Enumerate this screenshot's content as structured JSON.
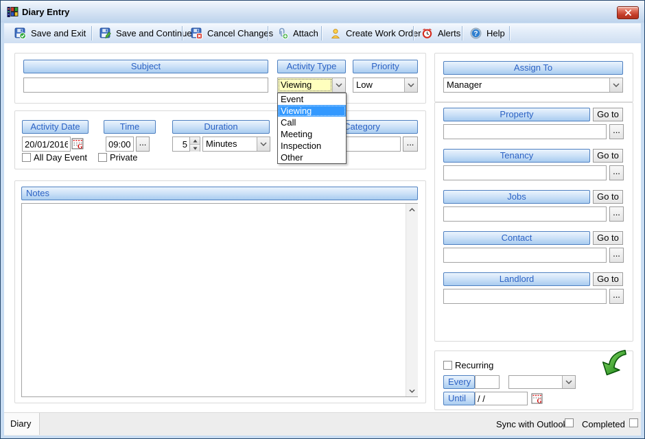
{
  "window": {
    "title": "Diary Entry"
  },
  "toolbar": {
    "buttons": [
      "Save and Exit",
      "Save and Continue",
      "Cancel Changes",
      "Attach",
      "Create Work Order",
      "Alerts",
      "Help"
    ]
  },
  "form": {
    "subject": {
      "header": "Subject",
      "value": ""
    },
    "activity_type": {
      "header": "Activity Type",
      "value": "Viewing",
      "options": [
        "Event",
        "Viewing",
        "Call",
        "Meeting",
        "Inspection",
        "Other"
      ],
      "selected": "Viewing"
    },
    "priority": {
      "header": "Priority",
      "value": "Low"
    },
    "activity_date": {
      "header": "Activity Date",
      "value": "20/01/2016"
    },
    "time": {
      "header": "Time",
      "value": "09:00"
    },
    "duration": {
      "header": "Duration",
      "value": "5",
      "unit": "Minutes"
    },
    "category": {
      "header": "Category",
      "value": ""
    },
    "all_day_label": "All Day Event",
    "private_label": "Private",
    "notes_header": "Notes"
  },
  "assign_to": {
    "header": "Assign To",
    "value": "Manager"
  },
  "links": {
    "items": [
      {
        "label": "Property"
      },
      {
        "label": "Tenancy"
      },
      {
        "label": "Jobs"
      },
      {
        "label": "Contact"
      },
      {
        "label": "Landlord"
      }
    ]
  },
  "recurring": {
    "label": "Recurring",
    "every_label": "Every",
    "until_label": "Until",
    "until_value": "/ /"
  },
  "statusbar": {
    "tab": "Diary",
    "sync_label": "Sync with Outlook",
    "completed_label": "Completed"
  },
  "ui": {
    "goto_label": "Go to",
    "ellipsis_label": "..."
  },
  "colors": {
    "header_text": "#2b62c4",
    "selection": "#3399ff",
    "focus_field": "#ffffbe",
    "close_button": "#c23a26",
    "frame": "#c8dcf2",
    "titlebar": "#bdd3ec"
  }
}
